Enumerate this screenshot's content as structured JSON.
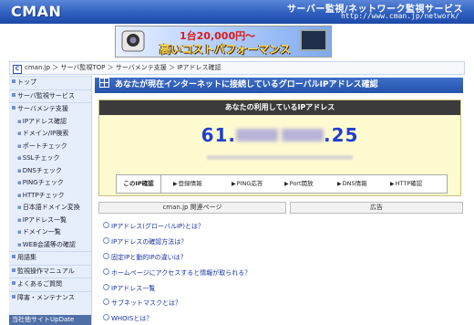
{
  "header": {
    "logo": "CMAN",
    "title": "サーバー監視/ネットワーク監視サービス",
    "url": "http://www.cman.jp/network/"
  },
  "banner": {
    "line1": "1台20,000円〜",
    "line2": "高いコストパフォーマンス"
  },
  "breadcrumb": "cman.jp ＞ サーバ監視TOP ＞ サーバメンテ支援 ＞ IPアドレス確認",
  "sidebar": {
    "items": [
      {
        "label": "トップ",
        "type": "cat"
      },
      {
        "label": "サーバ監視サービス",
        "type": "cat"
      },
      {
        "label": "サーバメンテ支援",
        "type": "cat"
      },
      {
        "label": "IPアドレス確認",
        "type": "sub"
      },
      {
        "label": "ドメイン/IP検索",
        "type": "sub"
      },
      {
        "label": "ポートチェック",
        "type": "sub"
      },
      {
        "label": "SSLチェック",
        "type": "sub"
      },
      {
        "label": "DNSチェック",
        "type": "sub"
      },
      {
        "label": "PINGチェック",
        "type": "sub"
      },
      {
        "label": "HTTPチェック",
        "type": "sub"
      },
      {
        "label": "日本語ドメイン変換",
        "type": "sub"
      },
      {
        "label": "IPアドレス一覧",
        "type": "sub"
      },
      {
        "label": "ドメイン一覧",
        "type": "sub"
      },
      {
        "label": "WEB会議等の確認",
        "type": "sub"
      },
      {
        "label": "用語集",
        "type": "cat"
      },
      {
        "label": "監視操作マニュアル",
        "type": "cat"
      },
      {
        "label": "よくあるご質問",
        "type": "cat"
      },
      {
        "label": "障害・メンテナンス",
        "type": "cat"
      }
    ],
    "bottom": "当社他サイトUpDate"
  },
  "main": {
    "heading": "あなたが現在インターネットに接続しているグローバルIPアドレス確認",
    "panel_title": "あなたの利用しているIPアドレス",
    "ip_prefix": "61.",
    "ip_suffix": ".25",
    "tools": {
      "first": "このIP確認",
      "items": [
        "登録情報",
        "PING応答",
        "Port開放",
        "DNS情報",
        "HTTP確認"
      ]
    }
  },
  "related": {
    "title": "cman.jp 関連ページ",
    "items": [
      "IPアドレス(グローバルIP)とは？",
      "IPアドレスの確認方法は？",
      "固定IPと動的IPの違いは？",
      "ホームページにアクセスすると情報が取られる？",
      "IPアドレス一覧",
      "サブネットマスクとは？",
      "WHOISとは？"
    ]
  },
  "ad": {
    "title": "広告"
  }
}
